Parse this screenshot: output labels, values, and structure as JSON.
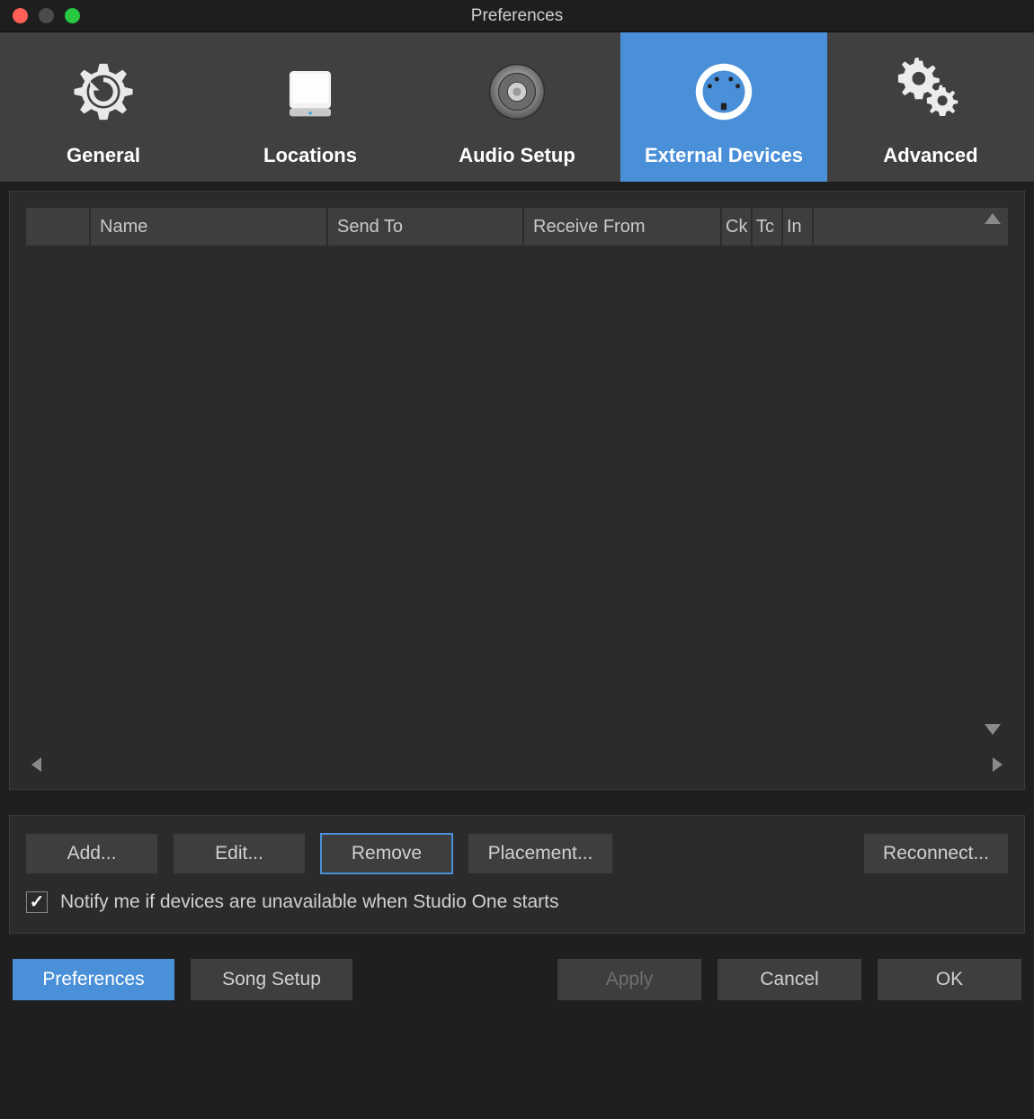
{
  "window": {
    "title": "Preferences"
  },
  "tabs": {
    "general": {
      "label": "General",
      "active": false
    },
    "locations": {
      "label": "Locations",
      "active": false
    },
    "audio": {
      "label": "Audio Setup",
      "active": false
    },
    "external": {
      "label": "External Devices",
      "active": true
    },
    "advanced": {
      "label": "Advanced",
      "active": false
    }
  },
  "table": {
    "columns": {
      "blank": "",
      "name": "Name",
      "send_to": "Send To",
      "receive_from": "Receive From",
      "ck": "Ck",
      "tc": "Tc",
      "in": "In",
      "blank2": ""
    },
    "rows": []
  },
  "actions": {
    "add": "Add...",
    "edit": "Edit...",
    "remove": "Remove",
    "placement": "Placement...",
    "reconnect": "Reconnect..."
  },
  "option": {
    "notify_checked": true,
    "notify_label": "Notify me if devices are unavailable when Studio One starts"
  },
  "footer": {
    "preferences": "Preferences",
    "song_setup": "Song Setup",
    "apply": "Apply",
    "cancel": "Cancel",
    "ok": "OK"
  }
}
